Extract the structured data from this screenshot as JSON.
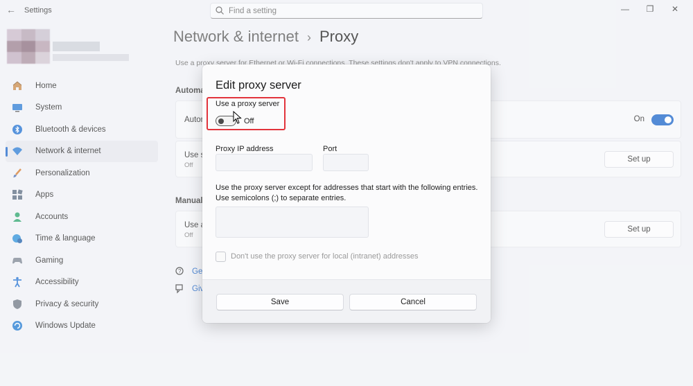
{
  "window": {
    "title": "Settings",
    "minimize": "—",
    "maximize": "❐",
    "close": "✕"
  },
  "search": {
    "placeholder": "Find a setting"
  },
  "sidebar": {
    "items": [
      {
        "label": "Home",
        "icon": "home-icon"
      },
      {
        "label": "System",
        "icon": "system-icon"
      },
      {
        "label": "Bluetooth & devices",
        "icon": "bluetooth-icon"
      },
      {
        "label": "Network & internet",
        "icon": "network-icon",
        "active": true
      },
      {
        "label": "Personalization",
        "icon": "brush-icon"
      },
      {
        "label": "Apps",
        "icon": "apps-icon"
      },
      {
        "label": "Accounts",
        "icon": "accounts-icon"
      },
      {
        "label": "Time & language",
        "icon": "globe-clock-icon"
      },
      {
        "label": "Gaming",
        "icon": "gaming-icon"
      },
      {
        "label": "Accessibility",
        "icon": "accessibility-icon"
      },
      {
        "label": "Privacy & security",
        "icon": "shield-icon"
      },
      {
        "label": "Windows Update",
        "icon": "update-icon"
      }
    ]
  },
  "header": {
    "parent": "Network & internet",
    "separator": "›",
    "current": "Proxy"
  },
  "main": {
    "description": "Use a proxy server for Ethernet or Wi-Fi connections. These settings don't apply to VPN connections.",
    "auto_section": "Automa",
    "auto_detect": {
      "label": "Autom",
      "state": "On"
    },
    "setup_script": {
      "label": "Use s",
      "sub": "Off",
      "button": "Set up"
    },
    "manual_section": "Manual",
    "manual_proxy": {
      "label": "Use a",
      "sub": "Off",
      "button": "Set up"
    },
    "links": [
      {
        "label": "Ge",
        "icon": "help-icon"
      },
      {
        "label": "Giv",
        "icon": "feedback-icon"
      }
    ]
  },
  "dialog": {
    "title": "Edit proxy server",
    "use_proxy_label": "Use a proxy server",
    "toggle_state": "Off",
    "ip_label": "Proxy IP address",
    "port_label": "Port",
    "ip_value": "",
    "port_value": "",
    "exceptions_line1": "Use the proxy server except for addresses that start with the following entries.",
    "exceptions_line2": "Use semicolons (;) to separate entries.",
    "exceptions_value": "",
    "local_checkbox": "Don't use the proxy server for local (intranet) addresses",
    "save": "Save",
    "cancel": "Cancel"
  },
  "colors": {
    "accent": "#1a64c8",
    "highlight": "#e2333b"
  }
}
